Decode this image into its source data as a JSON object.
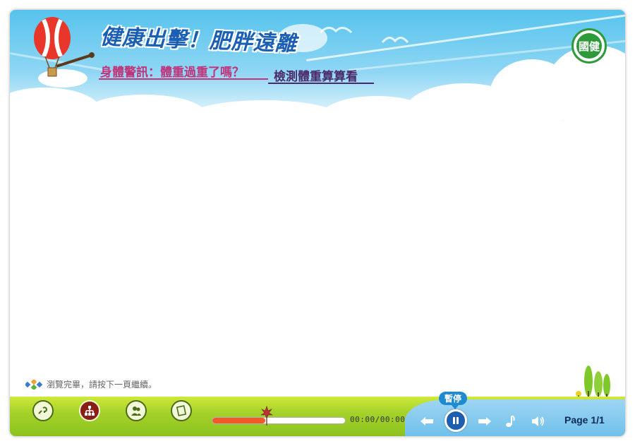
{
  "header": {
    "title": "健康出擊！肥胖遠離",
    "subtitle": "身體警訊：體重過重了嗎？",
    "lesson_title": "檢測體重算算看",
    "logo_text": "國健"
  },
  "status": {
    "message": "瀏覽完畢，請按下一頁繼續。"
  },
  "toolbar": {
    "nav_buttons": [
      "help-icon",
      "sitemap-icon",
      "people-icon",
      "notes-icon"
    ],
    "progress": 0.4,
    "time": "00:00/00:00",
    "pause_tooltip": "暫停",
    "page_label": "Page 1/1"
  },
  "colors": {
    "sky": "#56c3ec",
    "grass": "#a6d22a",
    "progress": "#ee5a2a",
    "pause": "#1e5eb0",
    "title": "#1a5fb4",
    "subtitle": "#c0347a"
  }
}
